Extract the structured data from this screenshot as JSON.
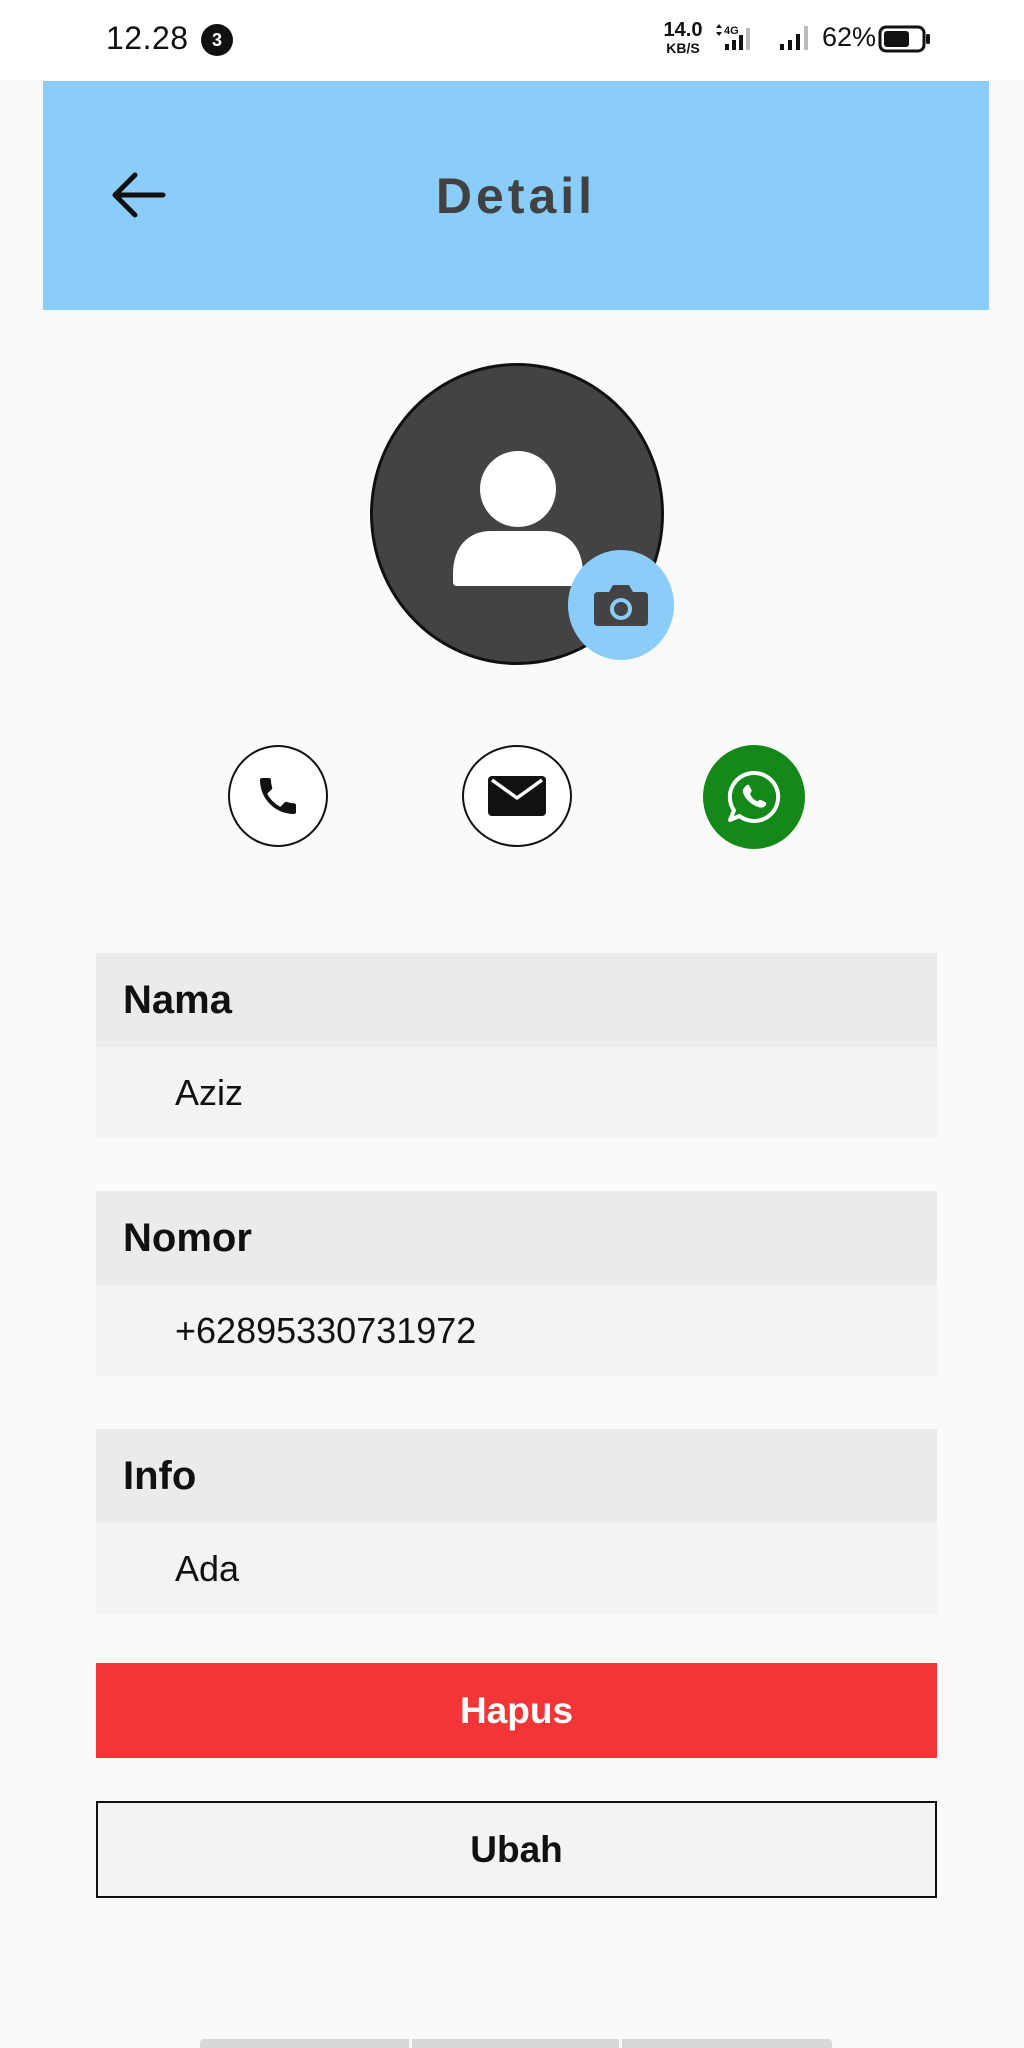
{
  "status_bar": {
    "time": "12.28",
    "notification_count": "3",
    "net_speed_value": "14.0",
    "net_speed_unit": "KB/S",
    "network_type": "4G",
    "battery_percent": "62%",
    "battery_level": 0.62
  },
  "app_bar": {
    "title": "Detail",
    "back_icon": "arrow-left-icon",
    "background_color": "#8acdf9"
  },
  "profile": {
    "avatar_icon": "person-icon",
    "camera_icon": "camera-icon"
  },
  "actions": [
    {
      "name": "call",
      "icon": "phone-icon"
    },
    {
      "name": "email",
      "icon": "envelope-icon"
    },
    {
      "name": "whatsapp",
      "icon": "whatsapp-icon",
      "color": "#14891a"
    }
  ],
  "fields": {
    "nama": {
      "label": "Nama",
      "value": "Aziz"
    },
    "nomor": {
      "label": "Nomor",
      "value": "+62895330731972"
    },
    "info": {
      "label": "Info",
      "value": "Ada"
    }
  },
  "buttons": {
    "delete_label": "Hapus",
    "delete_color": "#f23638",
    "edit_label": "Ubah"
  }
}
